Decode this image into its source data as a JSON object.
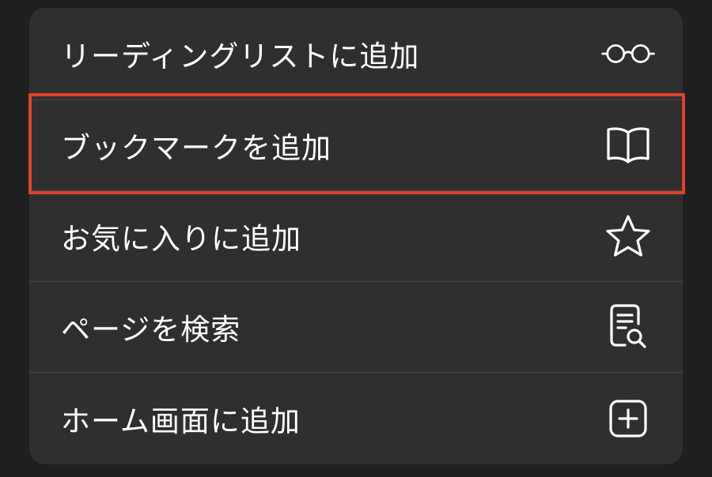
{
  "colors": {
    "background": "#1f1f1f",
    "menu_background": "#2f2f2f",
    "text": "#ffffff",
    "divider": "#444444",
    "highlight": "#e2422b"
  },
  "menu": {
    "items": [
      {
        "label": "リーディングリストに追加",
        "icon": "glasses-icon"
      },
      {
        "label": "ブックマークを追加",
        "icon": "book-icon",
        "highlighted": true
      },
      {
        "label": "お気に入りに追加",
        "icon": "star-icon"
      },
      {
        "label": "ページを検索",
        "icon": "document-search-icon"
      },
      {
        "label": "ホーム画面に追加",
        "icon": "plus-square-icon"
      }
    ]
  }
}
